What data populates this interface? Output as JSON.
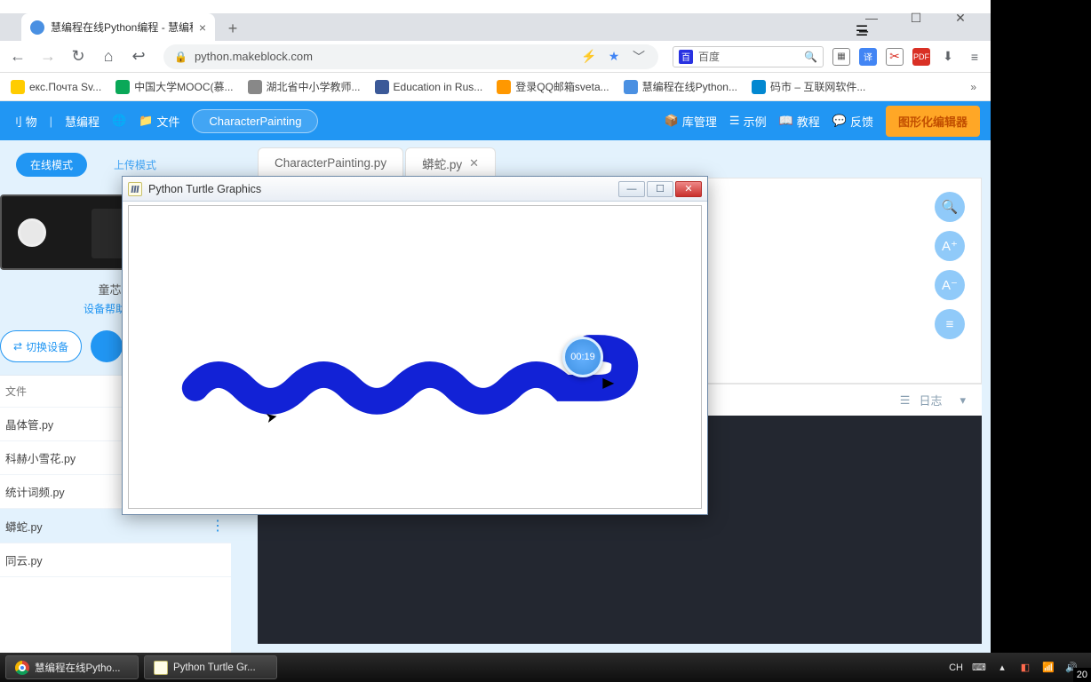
{
  "browser": {
    "tab_title": "慧编程在线Python编程 - 慧编程",
    "url": "python.makeblock.com",
    "search_engine": "百度",
    "bookmarks": [
      {
        "label": "екс.Почта Sv...",
        "color": "#ffcc00"
      },
      {
        "label": "中国大学MOOC(慕...",
        "color": "#0aa858"
      },
      {
        "label": "湖北省中小学教师...",
        "color": "#888"
      },
      {
        "label": "Education in Rus...",
        "color": "#3b5998"
      },
      {
        "label": "登录QQ邮箱sveta...",
        "color": "#ff9800"
      },
      {
        "label": "慧编程在线Python...",
        "color": "#4a90e2"
      },
      {
        "label": "码市 – 互联网软件...",
        "color": "#0288d1"
      }
    ]
  },
  "app": {
    "brand_a": "刂 物",
    "brand_b": "慧编程",
    "file_menu": "文件",
    "project_name": "CharacterPainting",
    "lib_mgr": "库管理",
    "examples": "示例",
    "tutorials": "教程",
    "feedback": "反馈",
    "block_editor_btn": "图形化编辑器"
  },
  "sidebar": {
    "mode_online": "在线模式",
    "mode_upload": "上传模式",
    "device_name": "童芯派",
    "device_help": "设备帮助文档",
    "switch_device": "切换设备",
    "files_header": "文件",
    "files": [
      {
        "name": "晶体管.py"
      },
      {
        "name": "科赫小雪花.py"
      },
      {
        "name": "统计词频.py"
      },
      {
        "name": "蟒蛇.py",
        "selected": true
      },
      {
        "name": "同云.py"
      }
    ]
  },
  "editor": {
    "tabs": [
      {
        "label": "CharacterPainting.py",
        "closable": false
      },
      {
        "label": "蟒蛇.py",
        "closable": true
      }
    ],
    "console_label": "日志"
  },
  "turtle": {
    "title": "Python Turtle Graphics",
    "timer": "00:19",
    "snake_color": "#1222d6"
  },
  "taskbar": {
    "items": [
      {
        "label": "慧编程在线Pytho...",
        "kind": "chrome"
      },
      {
        "label": "Python Turtle Gr...",
        "kind": "py"
      }
    ],
    "ime": "CH",
    "corner": "20"
  }
}
